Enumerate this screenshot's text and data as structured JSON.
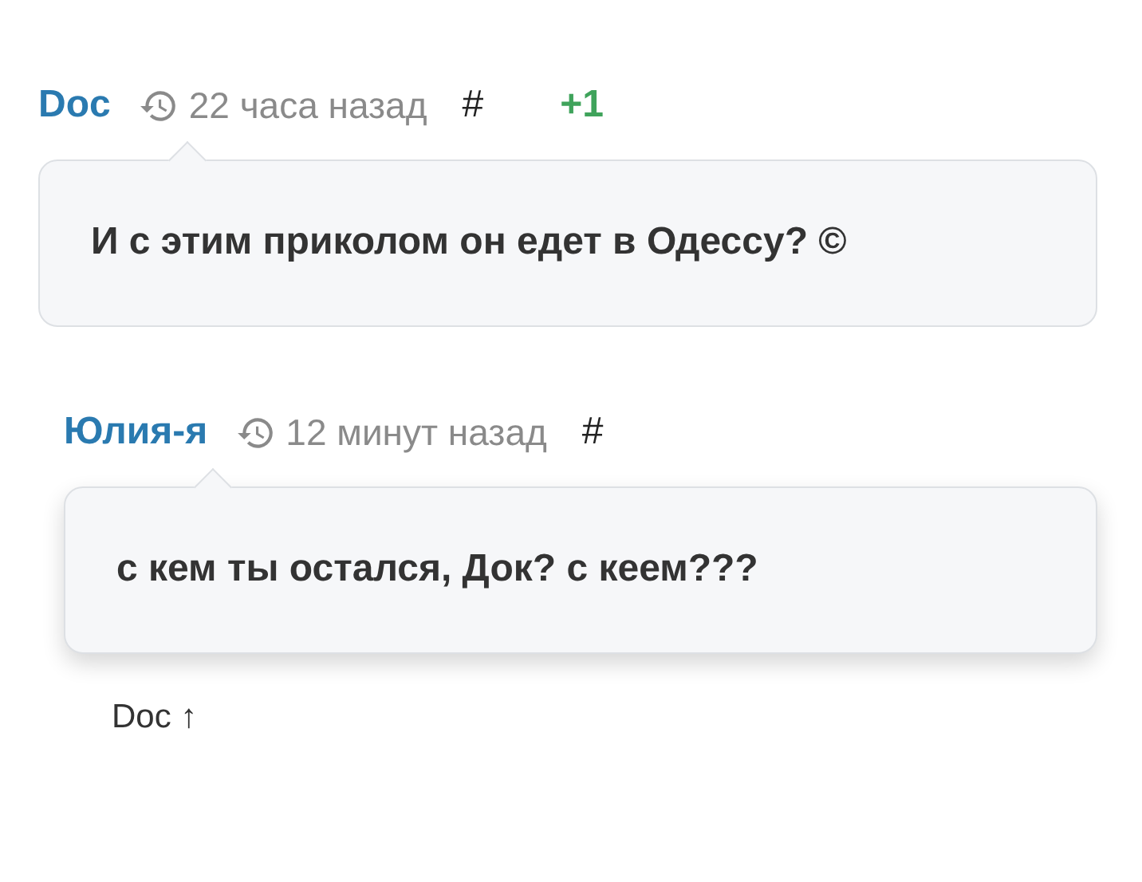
{
  "comments": [
    {
      "author": "Doc",
      "time": "22 часа назад",
      "anchor": "#",
      "score": "+1",
      "text": "И с этим приколом он едет в Одессу? ©",
      "highlighted": false,
      "children": [
        {
          "author": "Юлия-я",
          "time": "12 минут назад",
          "anchor": "#",
          "text": "с кем ты остался, Док? с кеем???",
          "highlighted": true,
          "parent_link": "Doc ↑"
        }
      ]
    }
  ]
}
